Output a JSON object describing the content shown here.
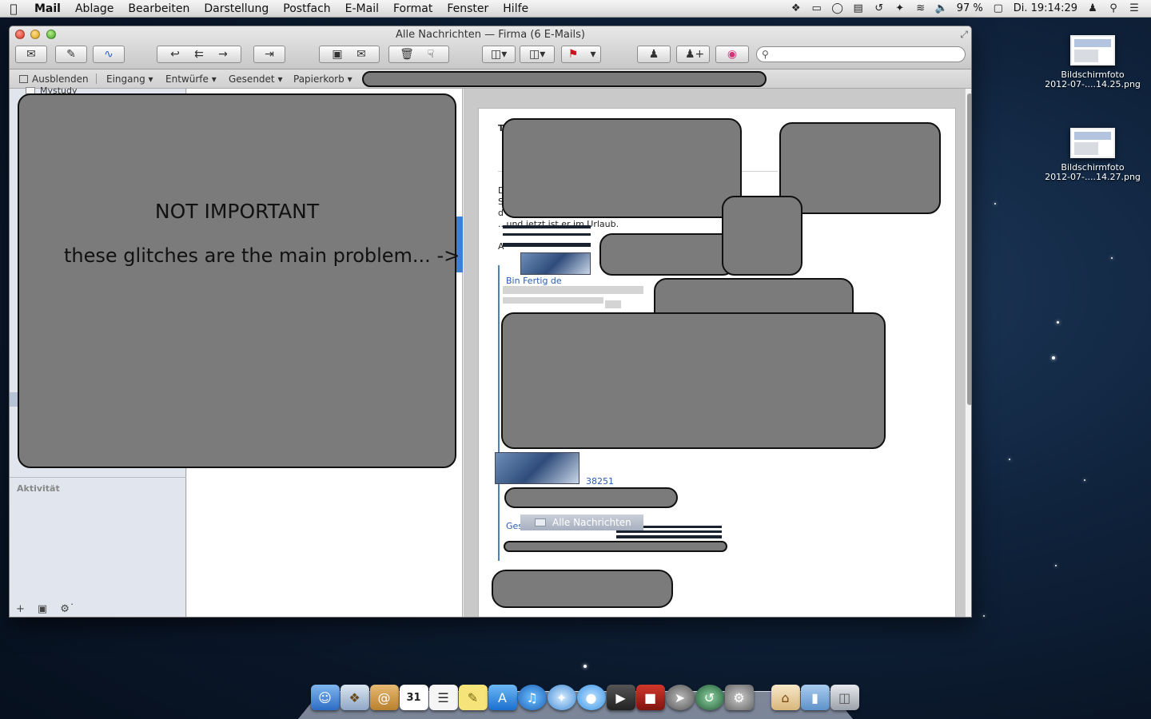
{
  "menubar": {
    "apple_icon": "apple-icon",
    "items": [
      "Mail",
      "Ablage",
      "Bearbeiten",
      "Darstellung",
      "Postfach",
      "E-Mail",
      "Format",
      "Fenster",
      "Hilfe"
    ],
    "battery": "97 %",
    "clock": "Di. 19:14:29"
  },
  "window": {
    "title": "Alle Nachrichten — Firma (6 E-Mails)",
    "search_placeholder": ""
  },
  "favorites": {
    "hide": "Ausblenden",
    "inbox": "Eingang",
    "drafts": "Entwürfe",
    "sent": "Gesendet",
    "trash": "Papierkorb"
  },
  "sidebar": {
    "peek_label": "Mystudy",
    "activity": "Aktivität"
  },
  "message": {
    "header_initial": "T",
    "line1": "D",
    "line2": "S",
    "line3": "d",
    "vacation": "...und jetzt ist er im Urlaub.",
    "a_label": "A",
    "link1": "Bin Fertig de",
    "link2": "38251",
    "link3": "Ges",
    "folder_tag": "Alle Nachrichten"
  },
  "overlay": {
    "line1": "NOT IMPORTANT",
    "line2": "these glitches are the main problem... ->"
  },
  "desktop": {
    "files": [
      {
        "name": "Bildschirmfoto",
        "sub": "2012-07-....14.25.png"
      },
      {
        "name": "Bildschirmfoto",
        "sub": "2012-07-....14.27.png"
      }
    ]
  },
  "dock": {
    "apps": [
      "finder",
      "mail",
      "contacts",
      "calendar",
      "reminders",
      "notes",
      "app-store",
      "itunes",
      "safari",
      "messages",
      "facetime",
      "photo-booth",
      "launchpad",
      "time-machine",
      "system-preferences",
      "home-folder",
      "documents-folder",
      "trash"
    ],
    "calendar_day": "31"
  },
  "colors": {
    "redaction": "#7b7b7b",
    "link": "#2a5db0",
    "selection": "#3b7fd6"
  }
}
